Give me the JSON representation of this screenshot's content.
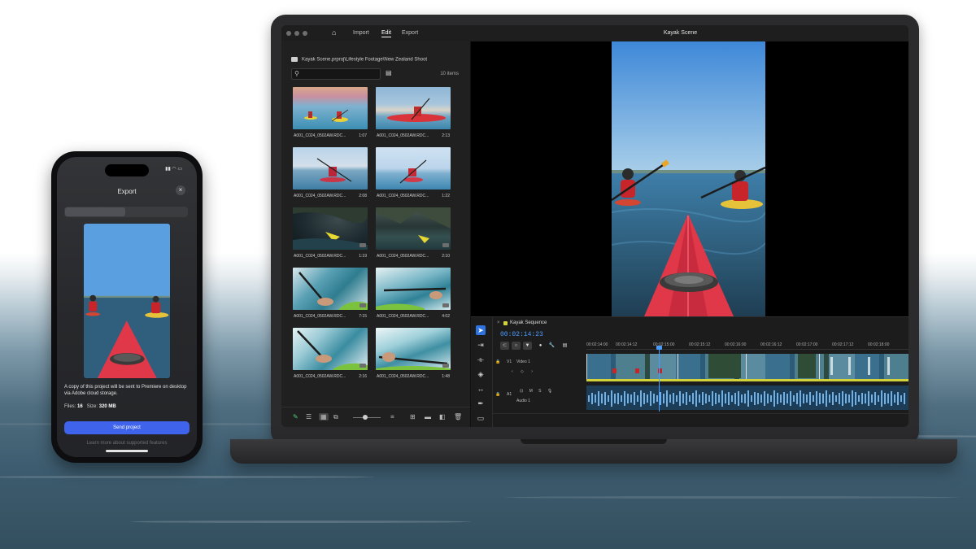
{
  "laptop": {
    "window_title": "Kayak Scene",
    "nav": [
      "Import",
      "Edit",
      "Export"
    ],
    "active_nav": "Edit",
    "media": {
      "path": "Kayak Scene.prproj\\Lifestyle Footage\\New Zealand Shoot",
      "items_count": "10 items",
      "clips": [
        {
          "name": "A001_C024_0502AW.RDC...",
          "duration": "1:07"
        },
        {
          "name": "A001_C024_0502AW.RDC...",
          "duration": "2:13"
        },
        {
          "name": "A001_C024_0502AW.RDC...",
          "duration": "2:08"
        },
        {
          "name": "A001_C024_0502AW.RDC...",
          "duration": "1:22"
        },
        {
          "name": "A001_C024_0502AW.RDC...",
          "duration": "1:19"
        },
        {
          "name": "A001_C024_0502AW.RDC...",
          "duration": "2:10"
        },
        {
          "name": "A001_C024_0502AW.RDC...",
          "duration": "7:15"
        },
        {
          "name": "A001_C024_0502AW.RDC...",
          "duration": "4:02"
        },
        {
          "name": "A001_C024_0502AW.RDC...",
          "duration": "2:16"
        },
        {
          "name": "A001_C024_0502AW.RDC...",
          "duration": "1:48"
        }
      ]
    },
    "timeline": {
      "sequence_name": "Kayak Sequence",
      "timecode": "00:02:14:23",
      "ruler": [
        "00:02:14:00",
        "00:02:14:12",
        "00:02:15:00",
        "00:02:15:12",
        "00:02:16:00",
        "00:02:16:12",
        "00:02:17:00",
        "00:02:17:12",
        "00:02:18:00"
      ],
      "video_track_label": "Video 1",
      "video_track_id": "V1",
      "audio_track_label": "Audio 1",
      "audio_track_id": "A1"
    }
  },
  "phone": {
    "status_time": "",
    "title": "Export",
    "info": "A copy of this project will be sent to Premiere on desktop via Adobe cloud storage.",
    "files_label": "Files:",
    "files_value": "16",
    "size_label": "Size:",
    "size_value": "320 MB",
    "send_button": "Send project",
    "learn_more": "Learn more about supported features"
  },
  "colors": {
    "accent_blue": "#3f63ea",
    "timecode_blue": "#4a9cff",
    "audio_track": "#1d3c56",
    "video_clip_trim": "#d2d23a"
  },
  "icons": [
    "home-icon",
    "search-icon",
    "filter-icon",
    "close-icon",
    "selection-tool-icon",
    "razor-tool-icon",
    "pen-tool-icon",
    "hand-tool-icon"
  ]
}
